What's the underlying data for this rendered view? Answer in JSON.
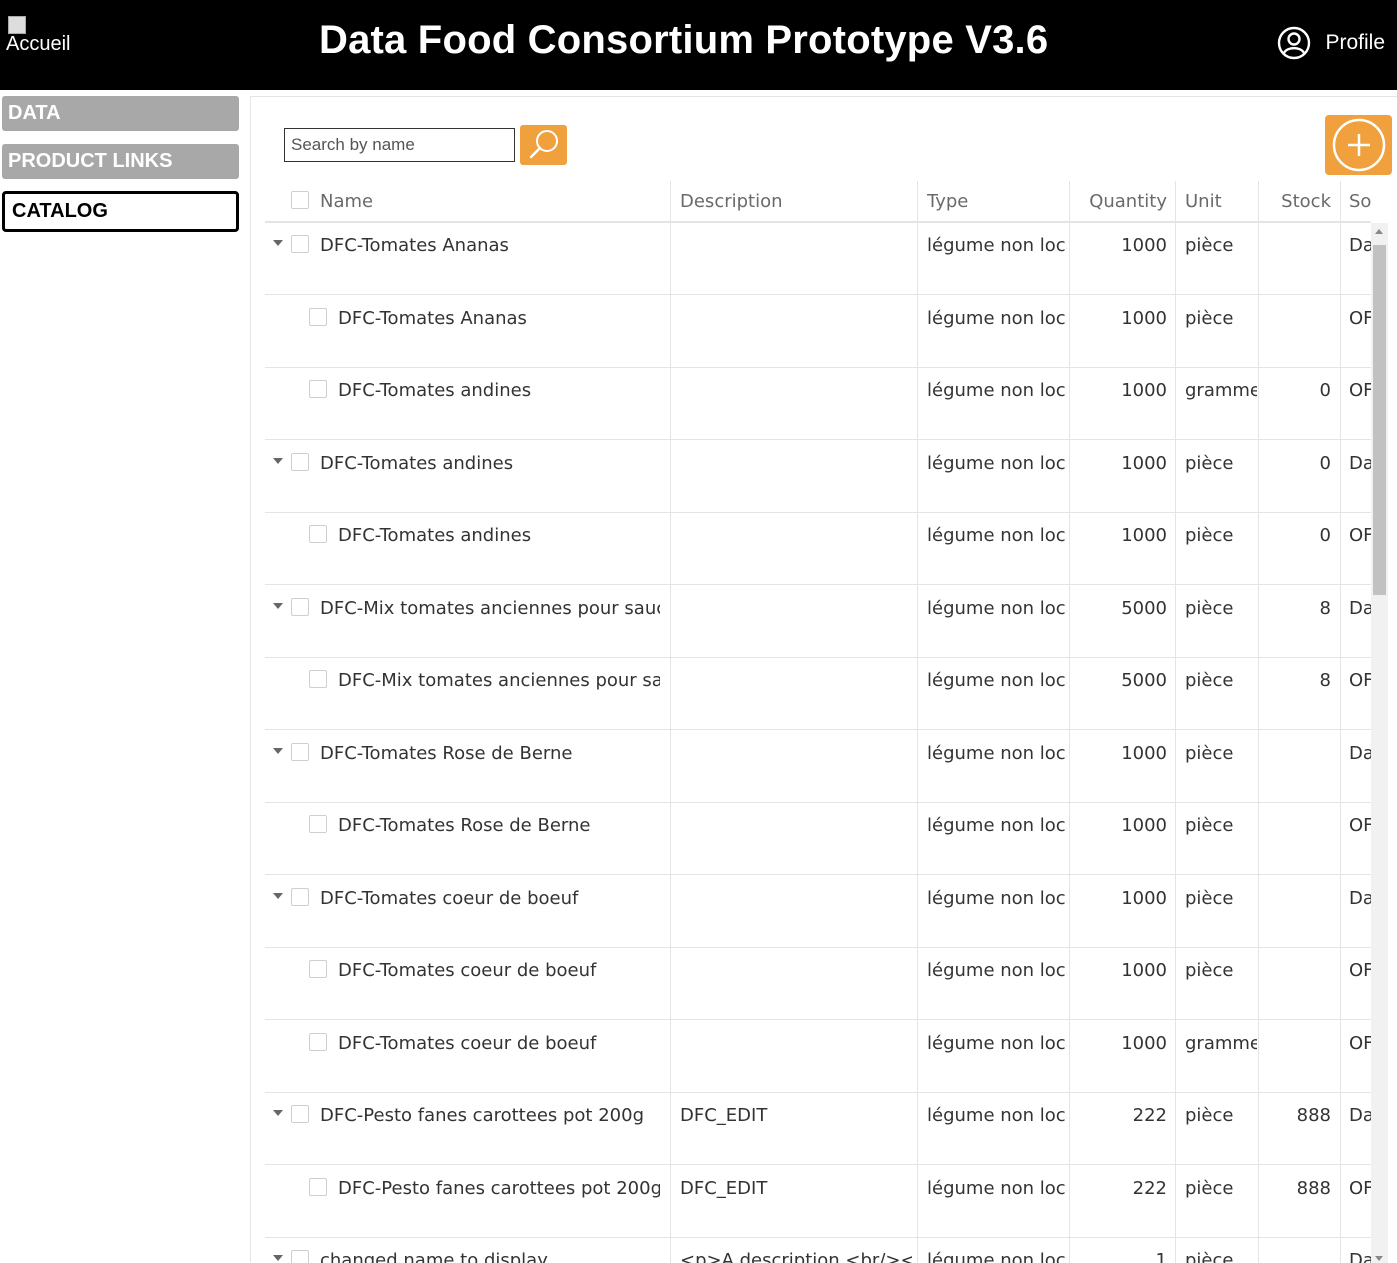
{
  "header": {
    "home_label": "Accueil",
    "title": "Data Food Consortium Prototype V3.6",
    "profile_label": "Profile",
    "background": "#000000",
    "icons": {
      "home": "broken-image-icon",
      "profile": "user-circle-icon"
    }
  },
  "sidebar": {
    "items": [
      {
        "label": "DATA",
        "active": false
      },
      {
        "label": "PRODUCT LINKS",
        "active": false
      },
      {
        "label": "CATALOG",
        "active": true
      }
    ]
  },
  "toolbar": {
    "search_placeholder": "Search by name",
    "search_icon": "search-icon",
    "add_icon": "plus-circle-icon",
    "accent": "#f0a03c"
  },
  "table": {
    "columns": [
      "Name",
      "Description",
      "Type",
      "Quantity",
      "Unit",
      "Stock",
      "So"
    ],
    "rows": [
      {
        "level": 0,
        "expandable": true,
        "name": "DFC-Tomates Ananas",
        "description": "",
        "type": "légume non local",
        "quantity": "1000",
        "unit": "pièce",
        "stock": "",
        "source": "Da"
      },
      {
        "level": 1,
        "expandable": false,
        "name": "DFC-Tomates Ananas",
        "description": "",
        "type": "légume non local",
        "quantity": "1000",
        "unit": "pièce",
        "stock": "",
        "source": "OF"
      },
      {
        "level": 1,
        "expandable": false,
        "name": "DFC-Tomates andines",
        "description": "",
        "type": "légume non local",
        "quantity": "1000",
        "unit": "gramme",
        "stock": "0",
        "source": "OF"
      },
      {
        "level": 0,
        "expandable": true,
        "name": "DFC-Tomates andines",
        "description": "",
        "type": "légume non local",
        "quantity": "1000",
        "unit": "pièce",
        "stock": "0",
        "source": "Da"
      },
      {
        "level": 1,
        "expandable": false,
        "name": "DFC-Tomates andines",
        "description": "",
        "type": "légume non local",
        "quantity": "1000",
        "unit": "pièce",
        "stock": "0",
        "source": "OF"
      },
      {
        "level": 0,
        "expandable": true,
        "name": "DFC-Mix tomates anciennes pour sauce",
        "description": "",
        "type": "légume non local",
        "quantity": "5000",
        "unit": "pièce",
        "stock": "8",
        "source": "Da"
      },
      {
        "level": 1,
        "expandable": false,
        "name": "DFC-Mix tomates anciennes pour sauce",
        "description": "",
        "type": "légume non local",
        "quantity": "5000",
        "unit": "pièce",
        "stock": "8",
        "source": "OF"
      },
      {
        "level": 0,
        "expandable": true,
        "name": "DFC-Tomates Rose de Berne",
        "description": "",
        "type": "légume non local",
        "quantity": "1000",
        "unit": "pièce",
        "stock": "",
        "source": "Da"
      },
      {
        "level": 1,
        "expandable": false,
        "name": "DFC-Tomates Rose de Berne",
        "description": "",
        "type": "légume non local",
        "quantity": "1000",
        "unit": "pièce",
        "stock": "",
        "source": "OF"
      },
      {
        "level": 0,
        "expandable": true,
        "name": "DFC-Tomates coeur de boeuf",
        "description": "",
        "type": "légume non local",
        "quantity": "1000",
        "unit": "pièce",
        "stock": "",
        "source": "Da"
      },
      {
        "level": 1,
        "expandable": false,
        "name": "DFC-Tomates coeur de boeuf",
        "description": "",
        "type": "légume non local",
        "quantity": "1000",
        "unit": "pièce",
        "stock": "",
        "source": "OF"
      },
      {
        "level": 1,
        "expandable": false,
        "name": "DFC-Tomates coeur de boeuf",
        "description": "",
        "type": "légume non local",
        "quantity": "1000",
        "unit": "gramme",
        "stock": "",
        "source": "OF"
      },
      {
        "level": 0,
        "expandable": true,
        "name": "DFC-Pesto fanes carottees pot 200g",
        "description": "DFC_EDIT",
        "type": "légume non local",
        "quantity": "222",
        "unit": "pièce",
        "stock": "888",
        "source": "Da"
      },
      {
        "level": 1,
        "expandable": false,
        "name": "DFC-Pesto fanes carottees pot 200g",
        "description": "DFC_EDIT",
        "type": "légume non local",
        "quantity": "222",
        "unit": "pièce",
        "stock": "888",
        "source": "OF"
      },
      {
        "level": 0,
        "expandable": true,
        "name": "changed name to display",
        "description": "<p>A description <br/></p>",
        "type": "légume non local",
        "quantity": "1",
        "unit": "pièce",
        "stock": "",
        "source": "Da"
      }
    ]
  }
}
